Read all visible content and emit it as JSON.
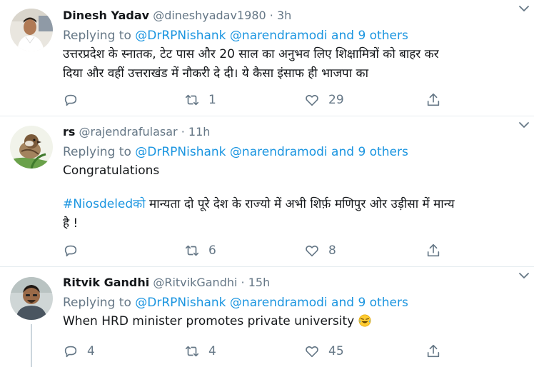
{
  "colors": {
    "link": "#1b95e0",
    "secondary": "#657786",
    "text": "#14171a",
    "divider": "#e6ecf0"
  },
  "tweets": [
    {
      "name": "Dinesh Yadav",
      "handle": "@dineshyadav1980",
      "dot": "·",
      "time": "3h",
      "replying_prefix": "Replying to",
      "mention1": "@DrRPNishank",
      "mention2": "@narendramodi",
      "and_text": "and",
      "others": "9 others",
      "text_line1": "उत्तरप्रदेश के स्नातक, टेट पास और 20 साल का अनुभव लिए शिक्षामित्रों को बाहर कर",
      "text_line2": "दिया और वहीं उत्तराखंड में नौकरी दे दी। ये कैसा इंसाफ ही भाजपा का",
      "reply_count": "",
      "retweet_count": "1",
      "like_count": "29"
    },
    {
      "name": "rs",
      "handle": "@rajendrafulasar",
      "dot": "·",
      "time": "11h",
      "replying_prefix": "Replying to",
      "mention1": "@DrRPNishank",
      "mention2": "@narendramodi",
      "and_text": "and",
      "others": "9 others",
      "text_line1": "Congratulations",
      "hashtag": "#Niosdeled",
      "hashtag_suffix": "को",
      "text_line2": " मान्यता दो पूरे देश के राज्यो में अभी शिर्फ़ मणिपुर ओर उड़ीसा में मान्य",
      "text_line3": "है !",
      "reply_count": "",
      "retweet_count": "6",
      "like_count": "8"
    },
    {
      "name": "Ritvik Gandhi",
      "handle": "@RitvikGandhi",
      "dot": "·",
      "time": "15h",
      "replying_prefix": "Replying to",
      "mention1": "@DrRPNishank",
      "mention2": "@narendramodi",
      "and_text": "and",
      "others": "9 others",
      "text_line1": "When HRD minister promotes private university",
      "emoji": "face-with-tears-of-joy",
      "reply_count": "4",
      "retweet_count": "4",
      "like_count": "45"
    }
  ],
  "icons": {
    "caret": "chevron-down-icon",
    "reply": "reply-icon",
    "retweet": "retweet-icon",
    "like": "heart-icon",
    "share": "share-icon"
  }
}
